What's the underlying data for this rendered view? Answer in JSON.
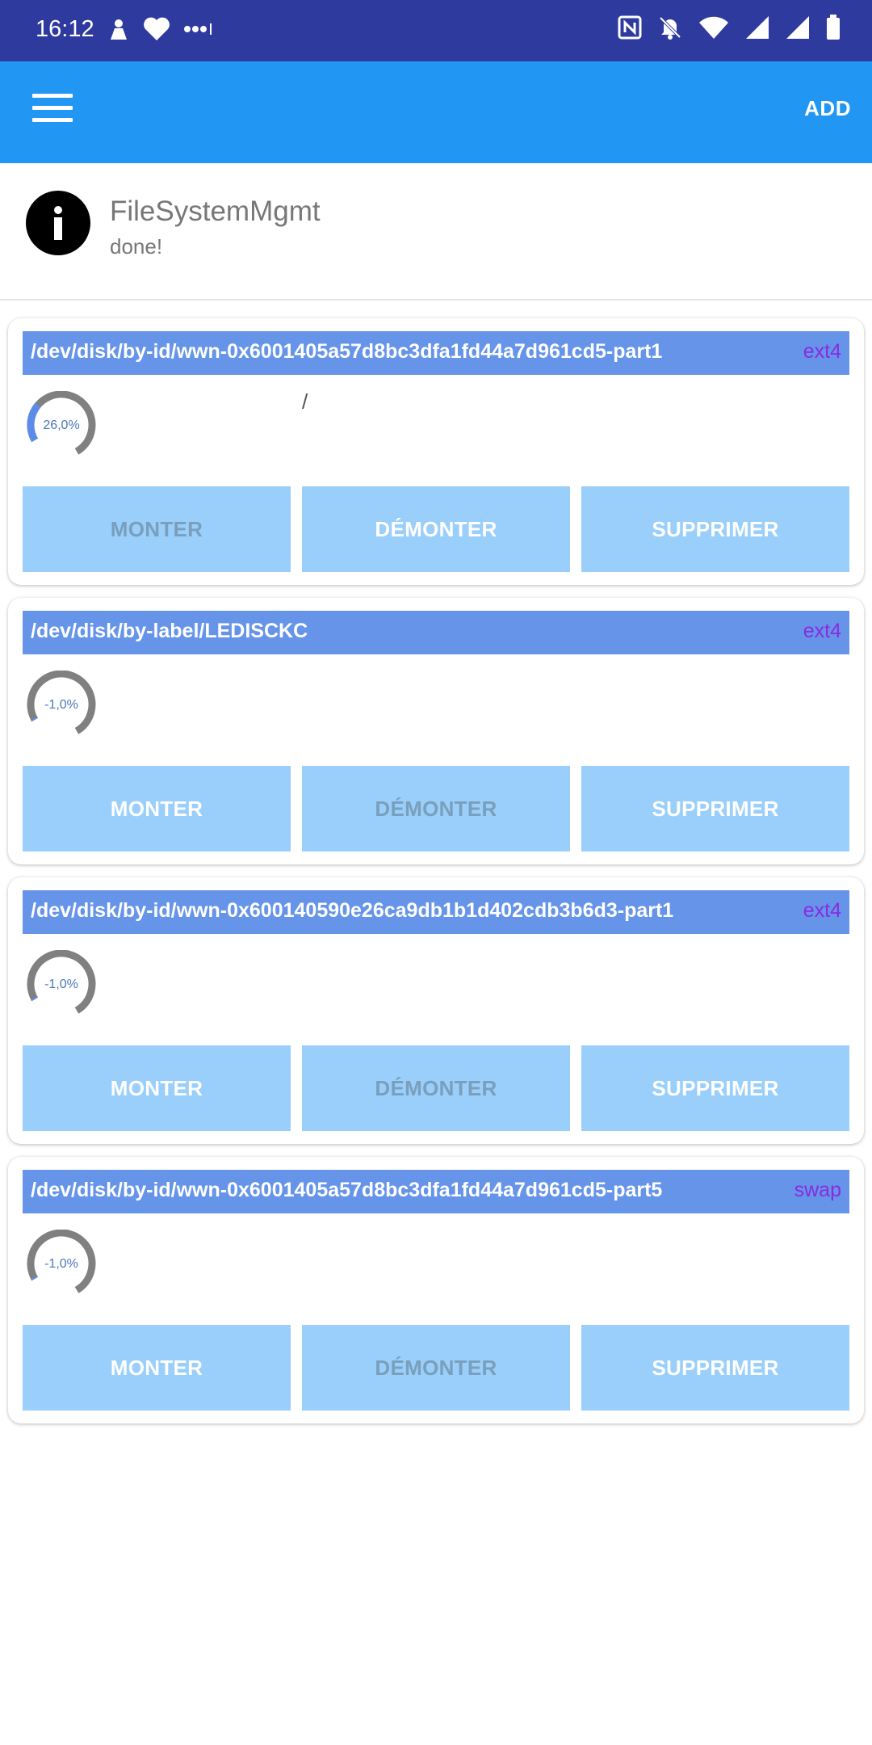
{
  "status_bar": {
    "time": "16:12"
  },
  "app_bar": {
    "add_label": "ADD"
  },
  "info": {
    "title": "FileSystemMgmt",
    "subtitle": "done!"
  },
  "colors": {
    "status_bar": "#2e3a9e",
    "app_bar": "#2196f3",
    "card_header": "#6594e8",
    "fs_type": "#8a2be2",
    "button": "#99cffa",
    "gauge_track": "#808080",
    "gauge_fill": "#5b8de8"
  },
  "cards": [
    {
      "path": "/dev/disk/by-id/wwn-0x6001405a57d8bc3dfa1fd44a7d961cd5-part1",
      "fs": "ext4",
      "usage": "26,0%",
      "usage_fraction": 0.26,
      "mount_point": "/",
      "buttons": {
        "mount": "MONTER",
        "unmount": "DÉMONTER",
        "delete": "SUPPRIMER"
      },
      "mounted": true
    },
    {
      "path": "/dev/disk/by-label/LEDISCKC",
      "fs": "ext4",
      "usage": "-1,0%",
      "usage_fraction": 0,
      "mount_point": "",
      "buttons": {
        "mount": "MONTER",
        "unmount": "DÉMONTER",
        "delete": "SUPPRIMER"
      },
      "mounted": false
    },
    {
      "path": "/dev/disk/by-id/wwn-0x600140590e26ca9db1b1d402cdb3b6d3-part1",
      "fs": "ext4",
      "usage": "-1,0%",
      "usage_fraction": 0,
      "mount_point": "",
      "buttons": {
        "mount": "MONTER",
        "unmount": "DÉMONTER",
        "delete": "SUPPRIMER"
      },
      "mounted": false
    },
    {
      "path": "/dev/disk/by-id/wwn-0x6001405a57d8bc3dfa1fd44a7d961cd5-part5",
      "fs": "swap",
      "usage": "-1,0%",
      "usage_fraction": 0,
      "mount_point": "",
      "buttons": {
        "mount": "MONTER",
        "unmount": "DÉMONTER",
        "delete": "SUPPRIMER"
      },
      "mounted": false
    }
  ]
}
